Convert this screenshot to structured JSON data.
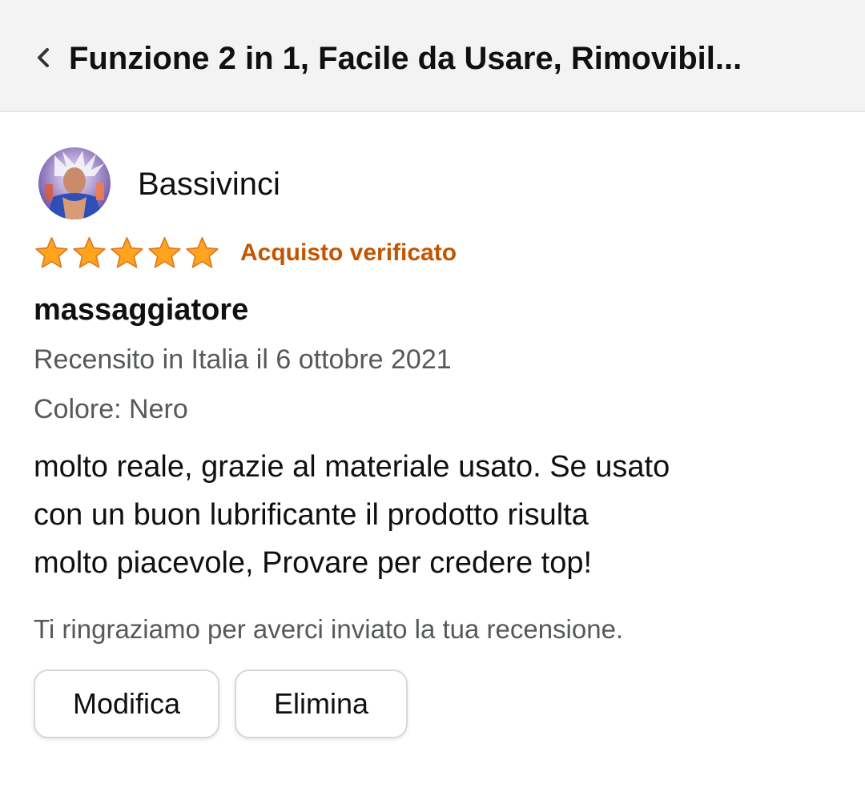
{
  "header": {
    "title": "Funzione 2 in 1, Facile da Usare, Rimovibil...",
    "back_icon": "chevron-left-icon"
  },
  "review": {
    "reviewer_name": "Bassivinci",
    "avatar_icon": "user-avatar-image",
    "rating": 5,
    "rating_max": 5,
    "verified_label": "Acquisto verificato",
    "title": "massaggiatore",
    "date_line": "Recensito in Italia il 6 ottobre 2021",
    "variant_line": "Colore: Nero",
    "body_lines": [
      "molto reale, grazie al materiale usato. Se usato",
      "con un buon lubrificante il prodotto risulta",
      "molto piacevole, Provare per credere top!"
    ],
    "thanks_message": "Ti ringraziamo per averci inviato la tua recensione."
  },
  "actions": {
    "edit_label": "Modifica",
    "delete_label": "Elimina"
  },
  "colors": {
    "header_bg": "#f3f3f3",
    "star": "#ffa41c",
    "verified": "#c45500",
    "secondary_text": "#565959",
    "primary_text": "#0f1111"
  }
}
